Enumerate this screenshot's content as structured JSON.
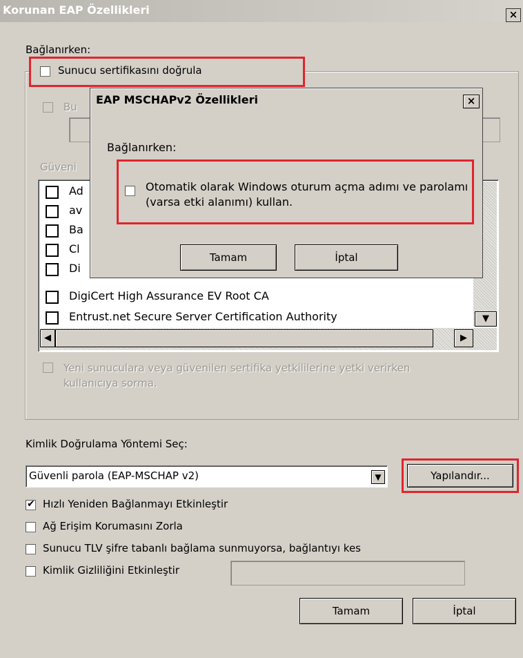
{
  "window": {
    "title": "Korunan EAP Özellikleri",
    "close": "×"
  },
  "connecting_label": "Bağlanırken:",
  "verify_cert_label": "Sunucu sertifikasını doğrula",
  "connect_servers_label_partial": "Bu",
  "trusted_roots_label_partial": "Güveni",
  "cert_list": [
    {
      "label": "Ad",
      "checked": false
    },
    {
      "label": "av",
      "checked": false
    },
    {
      "label": "Ba",
      "checked": false
    },
    {
      "label": "Cl",
      "checked": false
    },
    {
      "label": "Di",
      "checked": false
    },
    {
      "label": "DigiCert High Assurance EV Root CA",
      "checked": false
    },
    {
      "label": "Entrust.net Secure Server Certification Authority",
      "checked": false
    }
  ],
  "prompt_label": "Yeni sunuculara veya güvenilen sertifika yetkililerine yetki verirken kullanıcıya sorma.",
  "auth_method_label": "Kimlik Doğrulama Yöntemi Seç:",
  "auth_method_value": "Güvenli parola (EAP-MSCHAP v2)",
  "configure_button": "Yapılandır...",
  "options": [
    {
      "label": "Hızlı Yeniden Bağlanmayı Etkinleştir",
      "checked": true
    },
    {
      "label": "Ağ Erişim Korumasını Zorla",
      "checked": false
    },
    {
      "label": "Sunucu TLV şifre tabanlı bağlama sunmuyorsa, bağlantıyı kes",
      "checked": false
    },
    {
      "label": "Kimlik Gizliliğini Etkinleştir",
      "checked": false
    }
  ],
  "identity_value": "",
  "ok_button": "Tamam",
  "cancel_button": "İptal",
  "inner": {
    "title": "EAP MSCHAPv2 Özellikleri",
    "close": "×",
    "connecting_label": "Bağlanırken:",
    "auto_login_label": "Otomatik olarak Windows oturum açma adımı ve parolamı (varsa etki alanımı) kullan.",
    "auto_login_checked": false,
    "ok_button": "Tamam",
    "cancel_button": "İptal"
  },
  "colors": {
    "dialog_bg": "#d4d0c8",
    "highlight_red": "#e0242c",
    "title_bar": "#c0beb6"
  }
}
